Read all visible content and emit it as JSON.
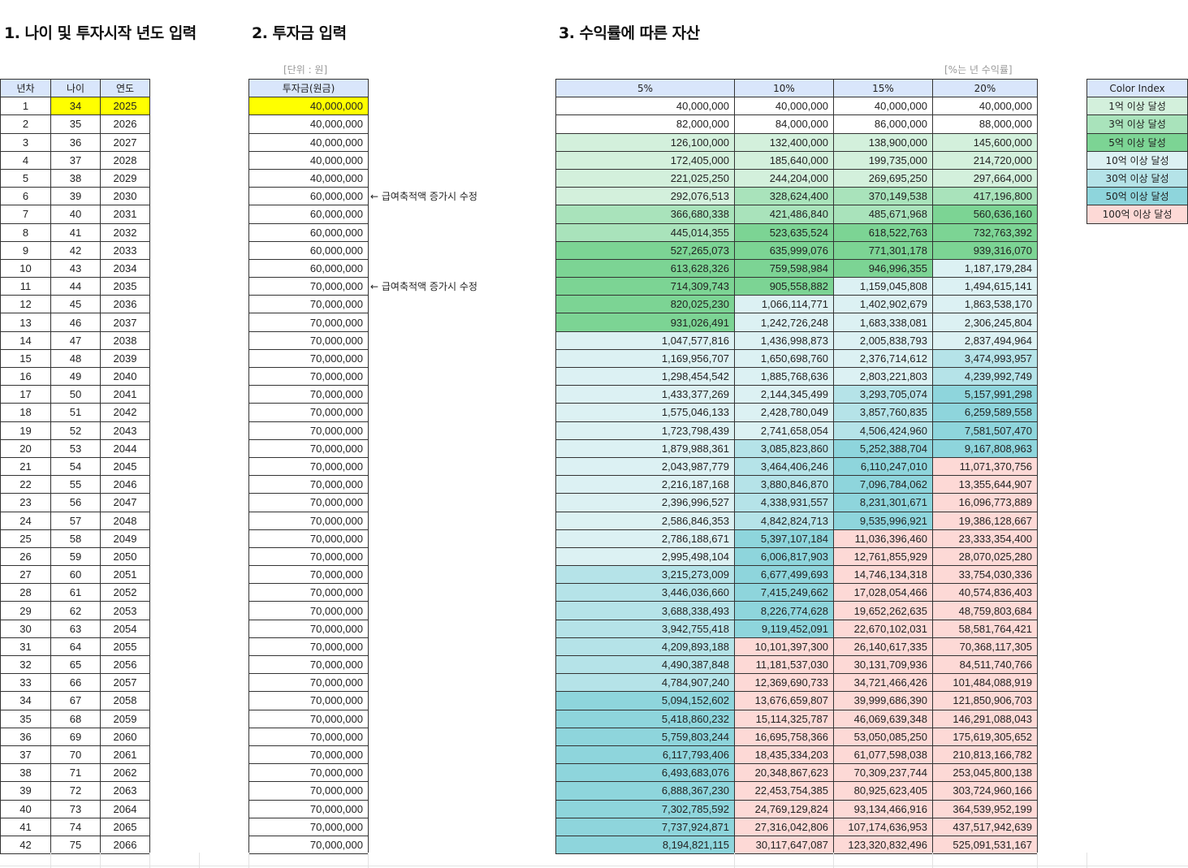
{
  "titles": {
    "section1": "1. 나이 및 투자시작 년도 입력",
    "section2": "2. 투자금 입력",
    "section3": "3. 수익률에 따른 자산"
  },
  "unit_note": "[단위 : 원]",
  "rate_note": "[%는 년 수익률]",
  "left_headers": [
    "년차",
    "나이",
    "연도"
  ],
  "invest_header": "투자금(원금)",
  "return_headers": [
    "5%",
    "10%",
    "15%",
    "20%"
  ],
  "legend": {
    "header": "Color Index",
    "items": [
      {
        "label": "1억 이상 달성",
        "threshold": 100000000,
        "color": "#d3f0dc"
      },
      {
        "label": "3억 이상 달성",
        "threshold": 300000000,
        "color": "#a9e3bb"
      },
      {
        "label": "5억 이상 달성",
        "threshold": 500000000,
        "color": "#7cd494"
      },
      {
        "label": "10억 이상 달성",
        "threshold": 1000000000,
        "color": "#dcf1f3"
      },
      {
        "label": "30억 이상 달성",
        "threshold": 3000000000,
        "color": "#b5e3e8"
      },
      {
        "label": "50억 이상 달성",
        "threshold": 5000000000,
        "color": "#8ed5dc"
      },
      {
        "label": "100억 이상 달성",
        "threshold": 10000000000,
        "color": "#fdd9d6"
      }
    ]
  },
  "input_highlight_color": "#ffff00",
  "side_notes": [
    {
      "row": 6,
      "text": "← 급여축적액 증가시 수정"
    },
    {
      "row": 11,
      "text": "← 급여축적액 증가시 수정"
    }
  ],
  "rows": [
    [
      "1",
      "34",
      "2025",
      "40,000,000",
      "40,000,000",
      "40,000,000",
      "40,000,000",
      "40,000,000"
    ],
    [
      "2",
      "35",
      "2026",
      "40,000,000",
      "82,000,000",
      "84,000,000",
      "86,000,000",
      "88,000,000"
    ],
    [
      "3",
      "36",
      "2027",
      "40,000,000",
      "126,100,000",
      "132,400,000",
      "138,900,000",
      "145,600,000"
    ],
    [
      "4",
      "37",
      "2028",
      "40,000,000",
      "172,405,000",
      "185,640,000",
      "199,735,000",
      "214,720,000"
    ],
    [
      "5",
      "38",
      "2029",
      "40,000,000",
      "221,025,250",
      "244,204,000",
      "269,695,250",
      "297,664,000"
    ],
    [
      "6",
      "39",
      "2030",
      "60,000,000",
      "292,076,513",
      "328,624,400",
      "370,149,538",
      "417,196,800"
    ],
    [
      "7",
      "40",
      "2031",
      "60,000,000",
      "366,680,338",
      "421,486,840",
      "485,671,968",
      "560,636,160"
    ],
    [
      "8",
      "41",
      "2032",
      "60,000,000",
      "445,014,355",
      "523,635,524",
      "618,522,763",
      "732,763,392"
    ],
    [
      "9",
      "42",
      "2033",
      "60,000,000",
      "527,265,073",
      "635,999,076",
      "771,301,178",
      "939,316,070"
    ],
    [
      "10",
      "43",
      "2034",
      "60,000,000",
      "613,628,326",
      "759,598,984",
      "946,996,355",
      "1,187,179,284"
    ],
    [
      "11",
      "44",
      "2035",
      "70,000,000",
      "714,309,743",
      "905,558,882",
      "1,159,045,808",
      "1,494,615,141"
    ],
    [
      "12",
      "45",
      "2036",
      "70,000,000",
      "820,025,230",
      "1,066,114,771",
      "1,402,902,679",
      "1,863,538,170"
    ],
    [
      "13",
      "46",
      "2037",
      "70,000,000",
      "931,026,491",
      "1,242,726,248",
      "1,683,338,081",
      "2,306,245,804"
    ],
    [
      "14",
      "47",
      "2038",
      "70,000,000",
      "1,047,577,816",
      "1,436,998,873",
      "2,005,838,793",
      "2,837,494,964"
    ],
    [
      "15",
      "48",
      "2039",
      "70,000,000",
      "1,169,956,707",
      "1,650,698,760",
      "2,376,714,612",
      "3,474,993,957"
    ],
    [
      "16",
      "49",
      "2040",
      "70,000,000",
      "1,298,454,542",
      "1,885,768,636",
      "2,803,221,803",
      "4,239,992,749"
    ],
    [
      "17",
      "50",
      "2041",
      "70,000,000",
      "1,433,377,269",
      "2,144,345,499",
      "3,293,705,074",
      "5,157,991,298"
    ],
    [
      "18",
      "51",
      "2042",
      "70,000,000",
      "1,575,046,133",
      "2,428,780,049",
      "3,857,760,835",
      "6,259,589,558"
    ],
    [
      "19",
      "52",
      "2043",
      "70,000,000",
      "1,723,798,439",
      "2,741,658,054",
      "4,506,424,960",
      "7,581,507,470"
    ],
    [
      "20",
      "53",
      "2044",
      "70,000,000",
      "1,879,988,361",
      "3,085,823,860",
      "5,252,388,704",
      "9,167,808,963"
    ],
    [
      "21",
      "54",
      "2045",
      "70,000,000",
      "2,043,987,779",
      "3,464,406,246",
      "6,110,247,010",
      "11,071,370,756"
    ],
    [
      "22",
      "55",
      "2046",
      "70,000,000",
      "2,216,187,168",
      "3,880,846,870",
      "7,096,784,062",
      "13,355,644,907"
    ],
    [
      "23",
      "56",
      "2047",
      "70,000,000",
      "2,396,996,527",
      "4,338,931,557",
      "8,231,301,671",
      "16,096,773,889"
    ],
    [
      "24",
      "57",
      "2048",
      "70,000,000",
      "2,586,846,353",
      "4,842,824,713",
      "9,535,996,921",
      "19,386,128,667"
    ],
    [
      "25",
      "58",
      "2049",
      "70,000,000",
      "2,786,188,671",
      "5,397,107,184",
      "11,036,396,460",
      "23,333,354,400"
    ],
    [
      "26",
      "59",
      "2050",
      "70,000,000",
      "2,995,498,104",
      "6,006,817,903",
      "12,761,855,929",
      "28,070,025,280"
    ],
    [
      "27",
      "60",
      "2051",
      "70,000,000",
      "3,215,273,009",
      "6,677,499,693",
      "14,746,134,318",
      "33,754,030,336"
    ],
    [
      "28",
      "61",
      "2052",
      "70,000,000",
      "3,446,036,660",
      "7,415,249,662",
      "17,028,054,466",
      "40,574,836,403"
    ],
    [
      "29",
      "62",
      "2053",
      "70,000,000",
      "3,688,338,493",
      "8,226,774,628",
      "19,652,262,635",
      "48,759,803,684"
    ],
    [
      "30",
      "63",
      "2054",
      "70,000,000",
      "3,942,755,418",
      "9,119,452,091",
      "22,670,102,031",
      "58,581,764,421"
    ],
    [
      "31",
      "64",
      "2055",
      "70,000,000",
      "4,209,893,188",
      "10,101,397,300",
      "26,140,617,335",
      "70,368,117,305"
    ],
    [
      "32",
      "65",
      "2056",
      "70,000,000",
      "4,490,387,848",
      "11,181,537,030",
      "30,131,709,936",
      "84,511,740,766"
    ],
    [
      "33",
      "66",
      "2057",
      "70,000,000",
      "4,784,907,240",
      "12,369,690,733",
      "34,721,466,426",
      "101,484,088,919"
    ],
    [
      "34",
      "67",
      "2058",
      "70,000,000",
      "5,094,152,602",
      "13,676,659,807",
      "39,999,686,390",
      "121,850,906,703"
    ],
    [
      "35",
      "68",
      "2059",
      "70,000,000",
      "5,418,860,232",
      "15,114,325,787",
      "46,069,639,348",
      "146,291,088,043"
    ],
    [
      "36",
      "69",
      "2060",
      "70,000,000",
      "5,759,803,244",
      "16,695,758,366",
      "53,050,085,250",
      "175,619,305,652"
    ],
    [
      "37",
      "70",
      "2061",
      "70,000,000",
      "6,117,793,406",
      "18,435,334,203",
      "61,077,598,038",
      "210,813,166,782"
    ],
    [
      "38",
      "71",
      "2062",
      "70,000,000",
      "6,493,683,076",
      "20,348,867,623",
      "70,309,237,744",
      "253,045,800,138"
    ],
    [
      "39",
      "72",
      "2063",
      "70,000,000",
      "6,888,367,230",
      "22,453,754,385",
      "80,925,623,405",
      "303,724,960,166"
    ],
    [
      "40",
      "73",
      "2064",
      "70,000,000",
      "7,302,785,592",
      "24,769,129,824",
      "93,134,466,916",
      "364,539,952,199"
    ],
    [
      "41",
      "74",
      "2065",
      "70,000,000",
      "7,737,924,871",
      "27,316,042,806",
      "107,174,636,953",
      "437,517,942,639"
    ],
    [
      "42",
      "75",
      "2066",
      "70,000,000",
      "8,194,821,115",
      "30,117,647,087",
      "123,320,832,496",
      "525,091,531,167"
    ]
  ]
}
